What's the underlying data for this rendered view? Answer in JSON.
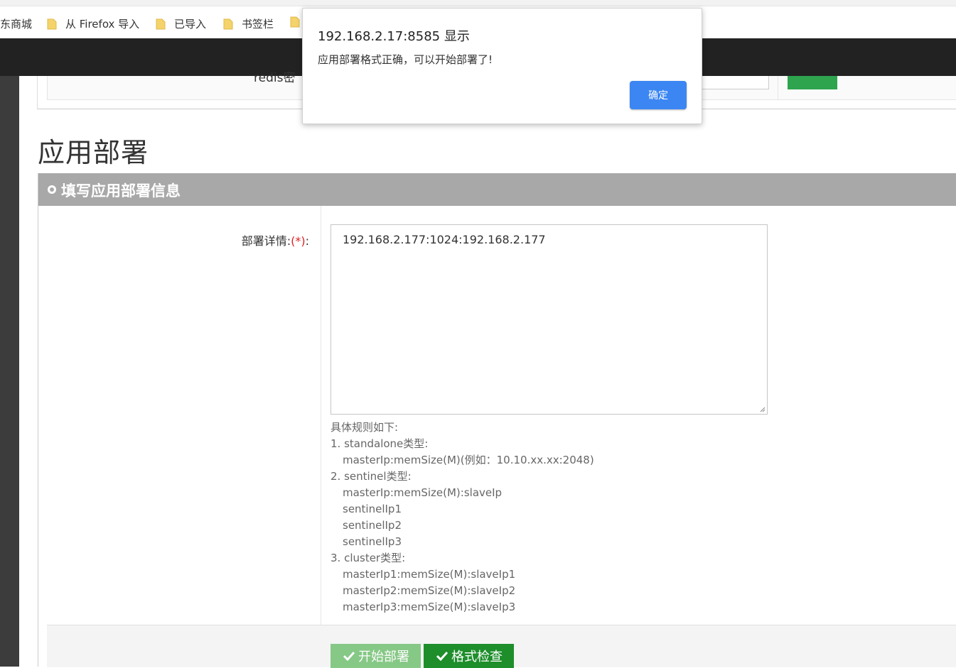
{
  "bookmarks": [
    {
      "label": "东商城",
      "folder": false
    },
    {
      "label": "从 Firefox 导入",
      "folder": true
    },
    {
      "label": "已导入",
      "folder": true
    },
    {
      "label": "书签栏",
      "folder": true
    }
  ],
  "prev_panel": {
    "label": "redis密"
  },
  "page": {
    "title": "应用部署"
  },
  "panel": {
    "title": "填写应用部署信息"
  },
  "form": {
    "label": "部署详情:",
    "required_mark": "(*)",
    "colon": ":",
    "textarea_value": "192.168.2.177:1024:192.168.2.177"
  },
  "rules": {
    "header": "具体规则如下:",
    "lines": [
      {
        "text": "1. standalone类型:",
        "indent": false
      },
      {
        "text": "masterIp:memSize(M)(例如：10.10.xx.xx:2048)",
        "indent": true
      },
      {
        "text": "2. sentinel类型:",
        "indent": false
      },
      {
        "text": "masterIp:memSize(M):slaveIp",
        "indent": true
      },
      {
        "text": "sentinelIp1",
        "indent": true
      },
      {
        "text": "sentinelIp2",
        "indent": true
      },
      {
        "text": "sentinelIp3",
        "indent": true
      },
      {
        "text": "3. cluster类型:",
        "indent": false
      },
      {
        "text": "masterIp1:memSize(M):slaveIp1",
        "indent": true
      },
      {
        "text": "masterIp2:memSize(M):slaveIp2",
        "indent": true
      },
      {
        "text": "masterIp3:memSize(M):slaveIp3",
        "indent": true
      }
    ]
  },
  "buttons": {
    "deploy": "开始部署",
    "check": "格式检查"
  },
  "dialog": {
    "title": "192.168.2.17:8585 显示",
    "message": "应用部署格式正确，可以开始部署了!",
    "ok": "确定"
  },
  "colors": {
    "navbar": "#222222",
    "panel_header": "#a8a8a8",
    "deploy_button": "#5cb85c",
    "check_button": "#1e8e2b",
    "dialog_ok": "#3b86f2",
    "required": "#e02020"
  }
}
